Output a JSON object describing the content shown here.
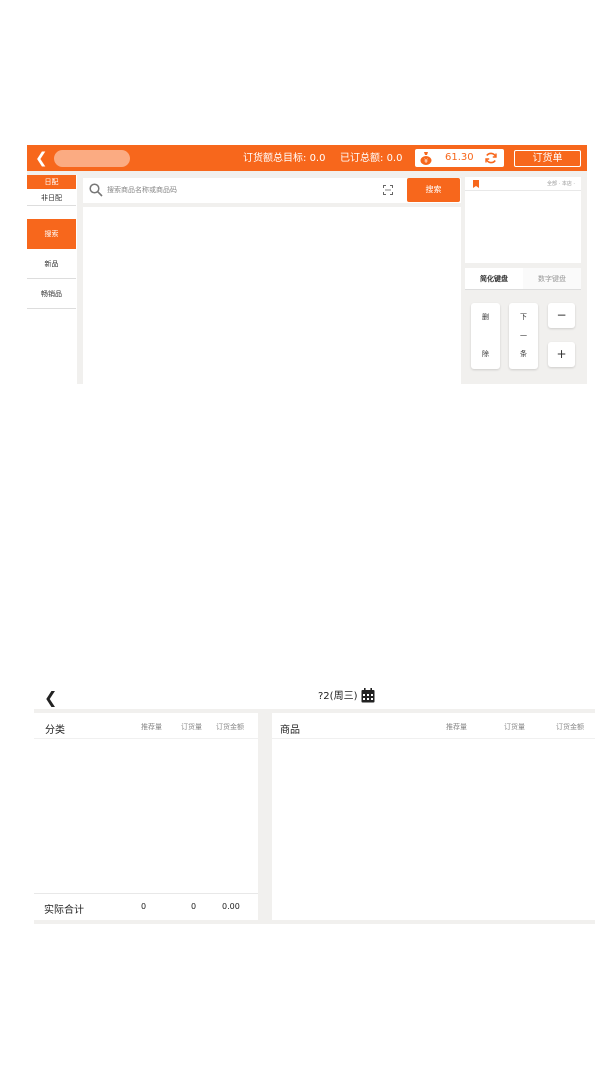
{
  "header": {
    "target_label": "订货额总目标:",
    "target_value": "0.0",
    "ordered_label": "已订总额:",
    "ordered_value": "0.0",
    "balance": "61.30",
    "order_button": "订货单"
  },
  "left_nav": {
    "items": [
      {
        "label": "日配",
        "selected": true
      },
      {
        "label": "非日配",
        "selected": false
      },
      {
        "label": "搜索",
        "selected": true
      },
      {
        "label": "新品",
        "selected": false
      },
      {
        "label": "畅销品",
        "selected": false
      }
    ]
  },
  "search": {
    "placeholder": "搜索商品名称或商品码",
    "button": "搜索"
  },
  "right_panel": {
    "filter": "全部 · 本店 ·"
  },
  "keyboard": {
    "tabs": [
      "简化键盘",
      "数字键盘"
    ],
    "delete_top": "删",
    "delete_bottom": "除",
    "next_top": "下",
    "next_mid": "一",
    "next_bottom": "条",
    "minus": "−",
    "plus": "+"
  },
  "summary": {
    "date": "?2(周三)",
    "left_table": {
      "headers": [
        "分类",
        "推荐量",
        "订货量",
        "订货金额"
      ],
      "total_label": "实际合计",
      "totals": [
        "0",
        "0",
        "0.00"
      ]
    },
    "right_table": {
      "headers": [
        "商品",
        "推荐量",
        "订货量",
        "订货金额"
      ]
    }
  },
  "colors": {
    "accent": "#f7671c",
    "panel_bg": "#f1f0ee"
  },
  "icons": [
    "back-arrow-icon",
    "money-bag-icon",
    "refresh-icon",
    "search-icon",
    "scan-icon",
    "bookmark-icon",
    "calendar-icon"
  ]
}
